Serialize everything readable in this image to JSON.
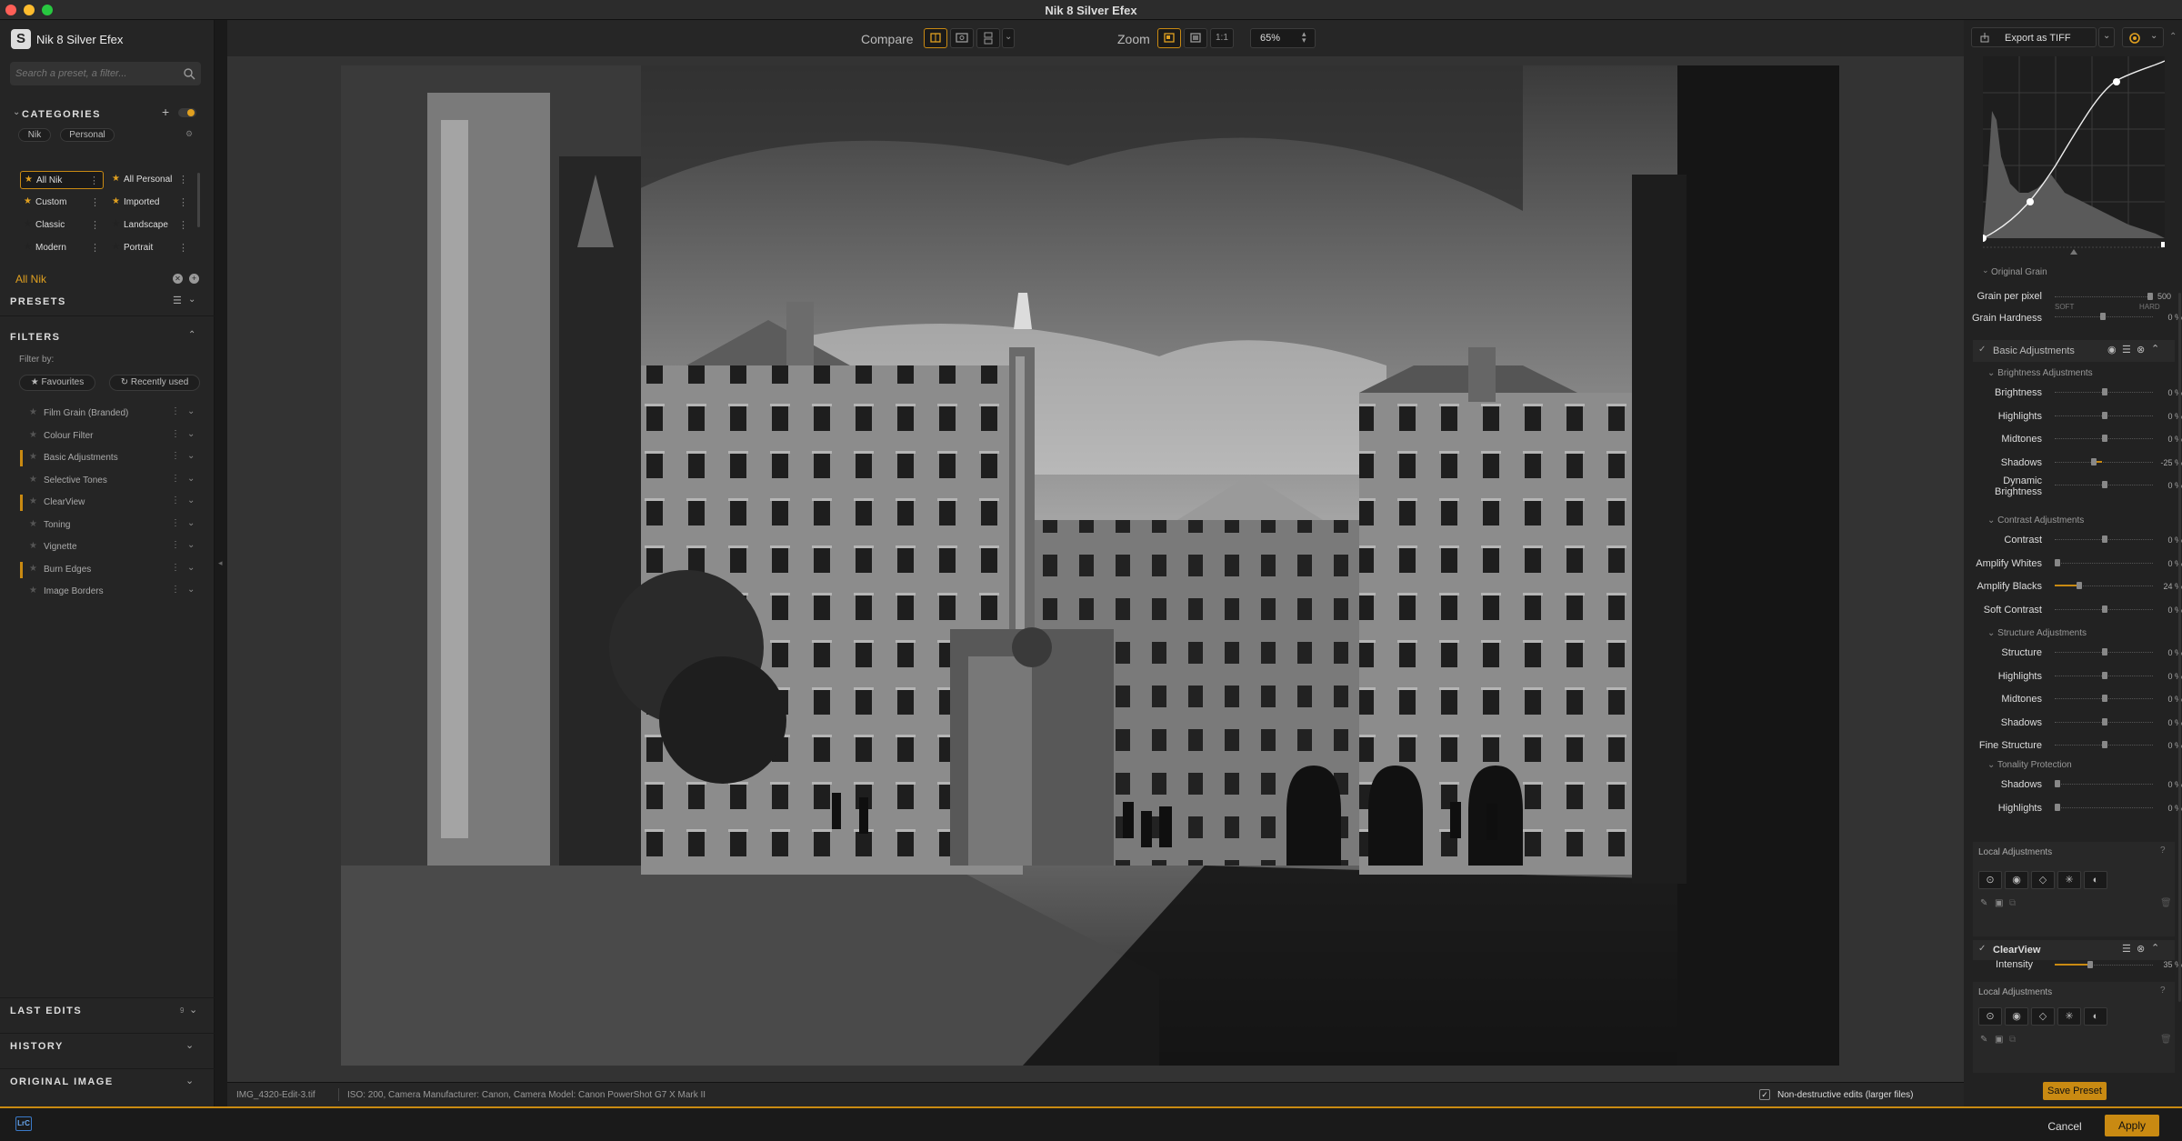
{
  "window": {
    "title": "Nik 8 Silver Efex"
  },
  "app": {
    "name": "Nik 8 Silver Efex",
    "logo_letter": "S"
  },
  "search": {
    "placeholder": "Search a preset, a filter..."
  },
  "categories": {
    "title": "CATEGORIES",
    "tabs": [
      "Nik",
      "Personal"
    ],
    "items": [
      {
        "label": "All Nik",
        "selected": true
      },
      {
        "label": "All Personal",
        "selected": false
      },
      {
        "label": "Custom",
        "selected": false
      },
      {
        "label": "Imported",
        "selected": false
      },
      {
        "label": "Classic",
        "selected": false
      },
      {
        "label": "Landscape",
        "selected": false
      },
      {
        "label": "Modern",
        "selected": false
      },
      {
        "label": "Portrait",
        "selected": false
      }
    ],
    "current": "All Nik"
  },
  "presets": {
    "title": "PRESETS"
  },
  "filters": {
    "title": "FILTERS",
    "filter_by": "Filter by:",
    "chips": [
      "Favourites",
      "Recently used"
    ],
    "items": [
      {
        "label": "Film Grain (Branded)",
        "active": false
      },
      {
        "label": "Colour Filter",
        "active": false
      },
      {
        "label": "Basic Adjustments",
        "active": true
      },
      {
        "label": "Selective Tones",
        "active": false
      },
      {
        "label": "ClearView",
        "active": true
      },
      {
        "label": "Toning",
        "active": false
      },
      {
        "label": "Vignette",
        "active": false
      },
      {
        "label": "Burn Edges",
        "active": true
      },
      {
        "label": "Image Borders",
        "active": false
      }
    ]
  },
  "last_edits": {
    "title": "LAST EDITS",
    "count": "9"
  },
  "history": {
    "title": "HISTORY"
  },
  "original_image": {
    "title": "ORIGINAL IMAGE"
  },
  "toolbar": {
    "compare_label": "Compare",
    "zoom_label": "Zoom",
    "zoom_one": "1:1",
    "zoom_value": "65%"
  },
  "status": {
    "filename": "IMG_4320-Edit-3.tif",
    "exif": "ISO: 200, Camera Manufacturer: Canon, Camera Model: Canon PowerShot G7 X Mark II",
    "nondestructive": "Non-destructive edits (larger files)"
  },
  "export": {
    "label": "Export as TIFF"
  },
  "grain": {
    "section": "Original Grain",
    "rows": [
      {
        "label": "Grain per pixel",
        "value": "500"
      },
      {
        "label": "Grain Hardness",
        "value": "0 %"
      }
    ],
    "soft": "SOFT",
    "hard": "HARD"
  },
  "basic": {
    "title": "Basic Adjustments",
    "brightness_section": "Brightness Adjustments",
    "brightness": [
      {
        "label": "Brightness",
        "value": "0 %"
      },
      {
        "label": "Highlights",
        "value": "0 %"
      },
      {
        "label": "Midtones",
        "value": "0 %"
      },
      {
        "label": "Shadows",
        "value": "-25 %"
      },
      {
        "label": "Dynamic Brightness",
        "value": "0 %"
      }
    ],
    "contrast_section": "Contrast Adjustments",
    "contrast": [
      {
        "label": "Contrast",
        "value": "0 %"
      },
      {
        "label": "Amplify Whites",
        "value": "0 %"
      },
      {
        "label": "Amplify Blacks",
        "value": "24 %"
      },
      {
        "label": "Soft Contrast",
        "value": "0 %"
      }
    ],
    "structure_section": "Structure Adjustments",
    "structure": [
      {
        "label": "Structure",
        "value": "0 %"
      },
      {
        "label": "Highlights",
        "value": "0 %"
      },
      {
        "label": "Midtones",
        "value": "0 %"
      },
      {
        "label": "Shadows",
        "value": "0 %"
      },
      {
        "label": "Fine Structure",
        "value": "0 %"
      }
    ],
    "tonality_section": "Tonality Protection",
    "tonality": [
      {
        "label": "Shadows",
        "value": "0 %"
      },
      {
        "label": "Highlights",
        "value": "0 %"
      }
    ],
    "local_title": "Local Adjustments"
  },
  "clearview": {
    "title": "ClearView",
    "intensity_label": "Intensity",
    "intensity_value": "35 %",
    "local_title": "Local Adjustments"
  },
  "actions": {
    "save_preset": "Save Preset",
    "cancel": "Cancel",
    "apply": "Apply"
  },
  "footer": {
    "lrc": "LrC"
  },
  "colors": {
    "accent": "#c98a12",
    "panel": "#252525",
    "canvas": "#333333"
  }
}
